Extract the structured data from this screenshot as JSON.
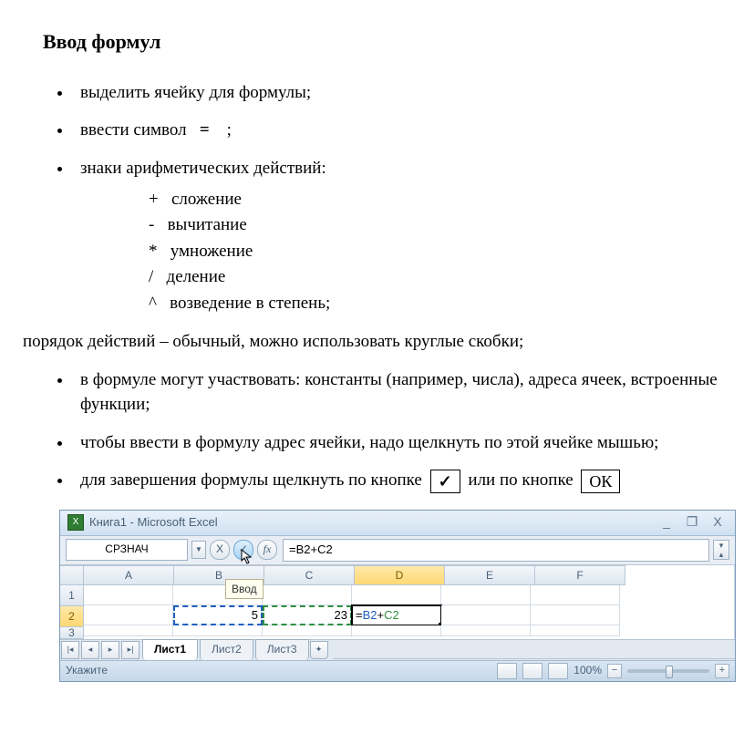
{
  "title": "Ввод формул",
  "bullets": {
    "b1": "выделить ячейку для формулы;",
    "b2a": "ввести символ",
    "b2sym": "=",
    "b2b": ";",
    "b3": "знаки арифметических действий:",
    "b4": "в формуле могут участвовать: константы (например, числа), адреса ячеек, встроенные функции;",
    "b5": "чтобы ввести в формулу адрес ячейки, надо щелкнуть по этой ячейке мышью;",
    "b6a": "для завершения формулы щелкнуть по кнопке",
    "b6b": "или по кнопке",
    "check": "✓",
    "ok": "ОК"
  },
  "ops": {
    "plus": "+   сложение",
    "minus": "-   вычитание",
    "mul": "*   умножение",
    "div": "/   деление",
    "pow": "^   возведение в степень;"
  },
  "note": "порядок действий – обычный, можно использовать круглые скобки;",
  "excel": {
    "windowTitle": "Книга1 - Microsoft Excel",
    "nameBox": "СРЗНАЧ",
    "cancel": "X",
    "enter": "✓",
    "fx": "fx",
    "formula": "=B2+C2",
    "tooltip": "Ввод",
    "cols": [
      "A",
      "B",
      "C",
      "D",
      "E",
      "F"
    ],
    "rows": [
      "1",
      "2",
      "3"
    ],
    "b2": "5",
    "c2": "23",
    "d2_eq": "=",
    "d2_b": "B2",
    "d2_plus": "+",
    "d2_c": "C2",
    "sheets": {
      "s1": "Лист1",
      "s2": "Лист2",
      "s3": "Лист3"
    },
    "status": "Укажите",
    "zoom": "100%",
    "minBtn": "_",
    "maxBtn": "❐",
    "closeBtn": "X"
  }
}
